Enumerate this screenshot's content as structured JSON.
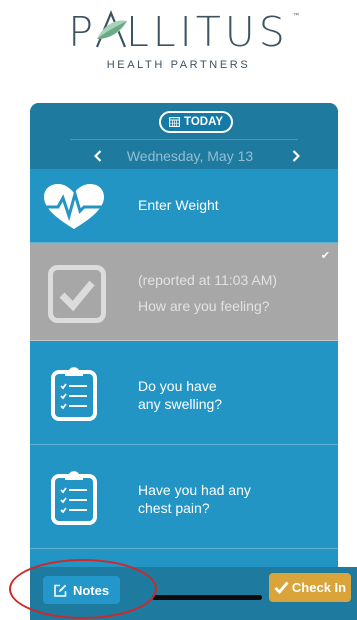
{
  "logo": {
    "word_before": "P",
    "word_after": "LLITUS",
    "trademark": "™",
    "subtitle": "HEALTH PARTNERS",
    "colors": {
      "text": "#3e5360",
      "leaf_dark": "#6aaa84",
      "leaf_light": "#a9d3b6"
    }
  },
  "header": {
    "today_label": "TODAY",
    "date_label": "Wednesday, May 13",
    "prev_icon": "chevron-left-icon",
    "next_icon": "chevron-right-icon"
  },
  "items": [
    {
      "icon": "heart-rate-icon",
      "lines": [
        "Enter Weight"
      ],
      "done": false
    },
    {
      "icon": "checkbox-checked-icon",
      "lines": [
        "(reported at 11:03 AM)",
        "How are you feeling?"
      ],
      "done": true,
      "status_mark": "✔"
    },
    {
      "icon": "clipboard-icon",
      "lines": [
        "Do you have",
        "any swelling?"
      ],
      "done": false
    },
    {
      "icon": "clipboard-icon",
      "lines": [
        "Have you had any",
        "chest pain?"
      ],
      "done": false
    },
    {
      "icon": "clipboard-icon",
      "lines": [],
      "done": false
    }
  ],
  "footer": {
    "notes_label": "Notes",
    "checkin_label": "Check In",
    "notes_icon": "edit-note-icon",
    "checkin_icon": "checkmark-icon"
  },
  "colors": {
    "panel": "#1e7a9e",
    "item": "#2295c4",
    "item_done": "#a7a7a7",
    "checkin": "#d9a53a",
    "annotation": "#cc2a2a"
  }
}
